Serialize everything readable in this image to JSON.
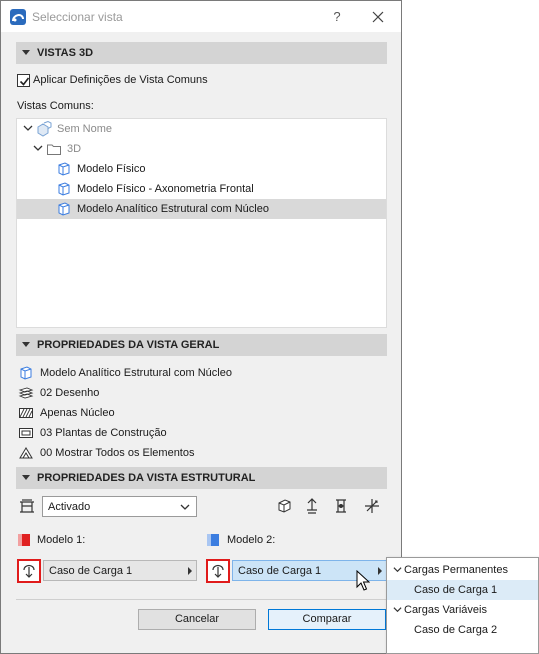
{
  "window": {
    "title": "Seleccionar vista",
    "help_label": "?"
  },
  "sections": {
    "vistas3d": "VISTAS 3D",
    "overview": "PROPRIEDADES DA VISTA GERAL",
    "structural": "PROPRIEDADES DA VISTA ESTRUTURAL"
  },
  "apply_defaults": {
    "label": "Aplicar Definições de Vista Comuns",
    "checked": true
  },
  "common_views_label": "Vistas Comuns:",
  "tree": {
    "items": [
      {
        "label": "Sem Nome",
        "level": 0,
        "expanded": true,
        "selected": false
      },
      {
        "label": "3D",
        "level": 1,
        "expanded": true,
        "selected": false
      },
      {
        "label": "Modelo Físico",
        "level": 2,
        "selected": false
      },
      {
        "label": "Modelo Físico - Axonometria Frontal",
        "level": 2,
        "selected": false
      },
      {
        "label": "Modelo Analítico Estrutural com Núcleo",
        "level": 2,
        "selected": true
      }
    ]
  },
  "overview_props": [
    {
      "icon": "view-cube-icon",
      "label": "Modelo Analítico Estrutural com Núcleo"
    },
    {
      "icon": "layers-icon",
      "label": "02 Desenho"
    },
    {
      "icon": "hatch-icon",
      "label": "Apenas Núcleo"
    },
    {
      "icon": "pen-set-icon",
      "label": "03 Plantas de Construção"
    },
    {
      "icon": "model-filter-icon",
      "label": "00 Mostrar Todos os Elementos"
    }
  ],
  "structural": {
    "display_value": "Activado",
    "model1_label": "Modelo 1:",
    "model2_label": "Modelo 2:",
    "model1_color": "#e02020",
    "model2_color": "#3b7de0",
    "model1_load": "Caso de Carga 1",
    "model2_load": "Caso de Carga 1"
  },
  "buttons": {
    "cancel": "Cancelar",
    "compare": "Comparar"
  },
  "dropdown_menu": {
    "groups": [
      {
        "label": "Cargas Permanentes",
        "items": [
          {
            "label": "Caso de Carga 1",
            "highlighted": true
          }
        ]
      },
      {
        "label": "Cargas Variáveis",
        "items": [
          {
            "label": "Caso de Carga 2",
            "highlighted": false
          }
        ]
      }
    ]
  },
  "colors": {
    "accent": "#0078d7",
    "highlight_red": "#e01b1b",
    "selection": "#d9d9d9",
    "menu_highlight": "#dcebf7",
    "field_highlight": "#cce4f7"
  }
}
